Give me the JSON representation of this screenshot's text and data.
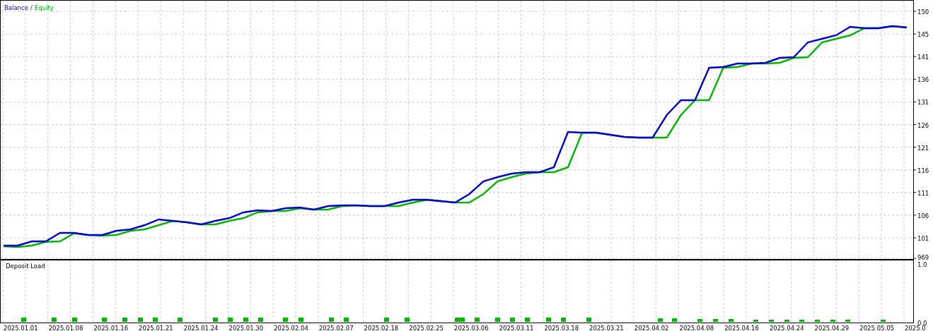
{
  "balance_chart": {
    "legend": [
      {
        "name": "Balance",
        "color": "#0000c8"
      },
      {
        "name": "Equity",
        "color": "#00b400"
      }
    ],
    "legend_separator": "/",
    "y_axis_labels": [
      "150",
      "145",
      "141",
      "136",
      "131",
      "126",
      "121",
      "116",
      "111",
      "106",
      "101",
      "969"
    ]
  },
  "deposit_load": {
    "title": "Deposit Load",
    "y_axis_labels": [
      "1.0",
      "0.0"
    ]
  },
  "x_axis_labels": [
    "2025.01.01",
    "2025.01.08",
    "2025.01.16",
    "2025.01.21",
    "2025.01.24",
    "2025.01.30",
    "2025.02.04",
    "2025.02.07",
    "2025.02.18",
    "2025.02.25",
    "2025.03.06",
    "2025.03.11",
    "2025.03.18",
    "2025.03.21",
    "2025.04.02",
    "2025.04.08",
    "2025.04.16",
    "2025.04.24",
    "2025.04.29",
    "2025.05.05",
    "2025.0"
  ]
}
